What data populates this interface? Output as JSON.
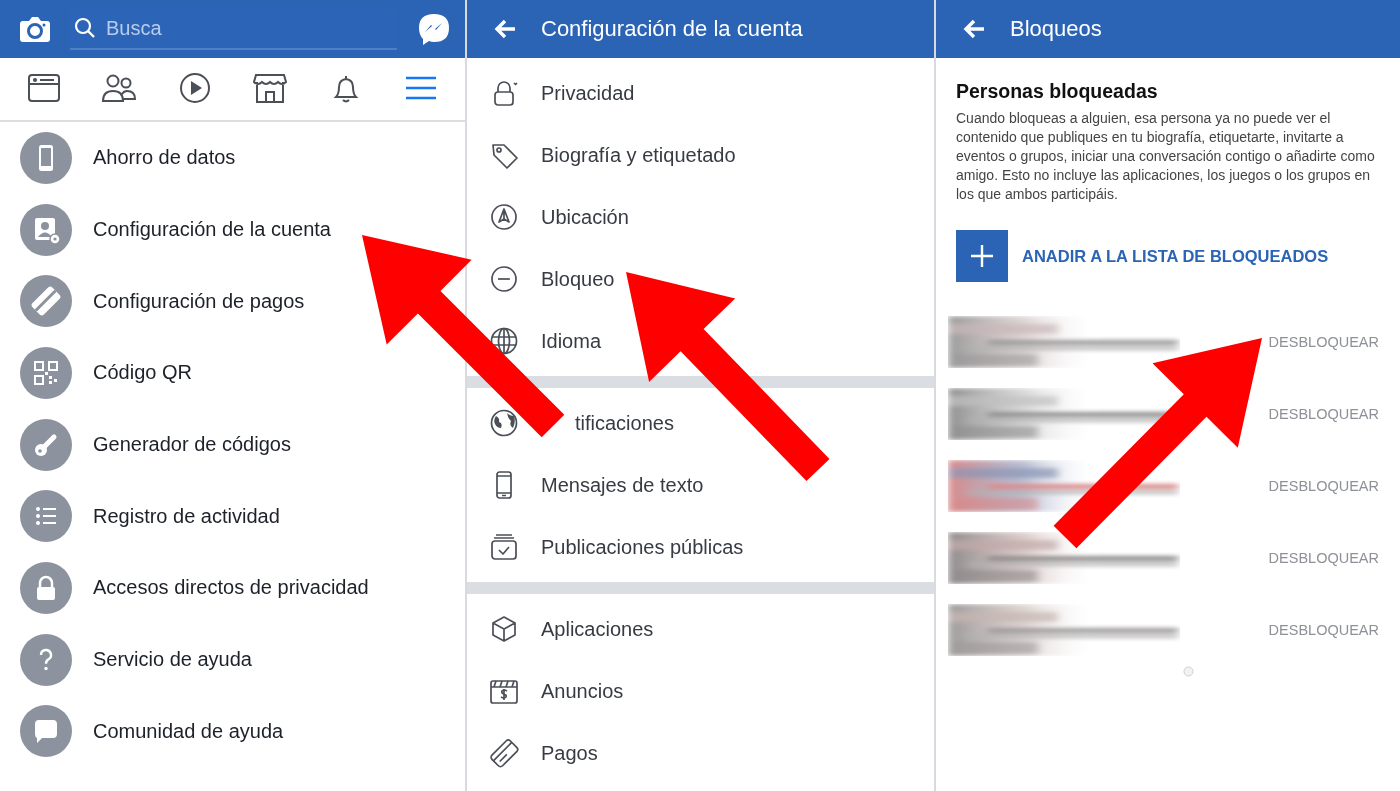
{
  "menu_screen": {
    "search": {
      "placeholder": "Busca"
    },
    "nav_tabs": [
      {
        "selected": false
      },
      {
        "selected": false
      },
      {
        "selected": false
      },
      {
        "selected": false
      },
      {
        "selected": false
      },
      {
        "selected": true
      }
    ],
    "items": [
      {
        "label": "Ahorro de datos"
      },
      {
        "label": "Configuración de la cuenta"
      },
      {
        "label": "Configuración de pagos"
      },
      {
        "label": "Código QR"
      },
      {
        "label": "Generador de códigos"
      },
      {
        "label": "Registro de actividad"
      },
      {
        "label": "Accesos directos de privacidad"
      },
      {
        "label": "Servicio de ayuda"
      },
      {
        "label": "Comunidad de ayuda"
      }
    ]
  },
  "settings_screen": {
    "title": "Configuración de la cuenta",
    "groups": [
      {
        "items": [
          {
            "label": "Privacidad"
          },
          {
            "label": "Biografía y etiquetado"
          },
          {
            "label": "Ubicación"
          },
          {
            "label": "Bloqueo"
          },
          {
            "label": "Idioma"
          }
        ]
      },
      {
        "items": [
          {
            "label": "tificaciones"
          },
          {
            "label": "Mensajes de texto"
          },
          {
            "label": "Publicaciones públicas"
          }
        ]
      },
      {
        "items": [
          {
            "label": "Aplicaciones"
          },
          {
            "label": "Anuncios"
          },
          {
            "label": "Pagos"
          }
        ]
      }
    ]
  },
  "blocking_screen": {
    "title": "Bloqueos",
    "heading": "Personas bloqueadas",
    "description": "Cuando bloqueas a alguien, esa persona ya no puede ver el contenido que publiques en tu biografía, etiquetarte, invitarte a eventos o grupos, iniciar una conversación contigo o añadirte como amigo. Esto no incluye las aplicaciones, los juegos o los grupos en los que ambos participáis.",
    "add_button": "ANADIR A LA LISTA DE BLOQUEADOS",
    "blocked": [
      {
        "kind": "picture",
        "action": "DESBLOQUEAR"
      },
      {
        "kind": "picture",
        "action": "DESBLOQUEAR"
      },
      {
        "kind": "picture",
        "action": "DESBLOQUEAR"
      },
      {
        "kind": "picture",
        "action": "DESBLOQUEAR"
      },
      {
        "kind": "picture",
        "action": "DESBLOQUEAR"
      }
    ]
  }
}
